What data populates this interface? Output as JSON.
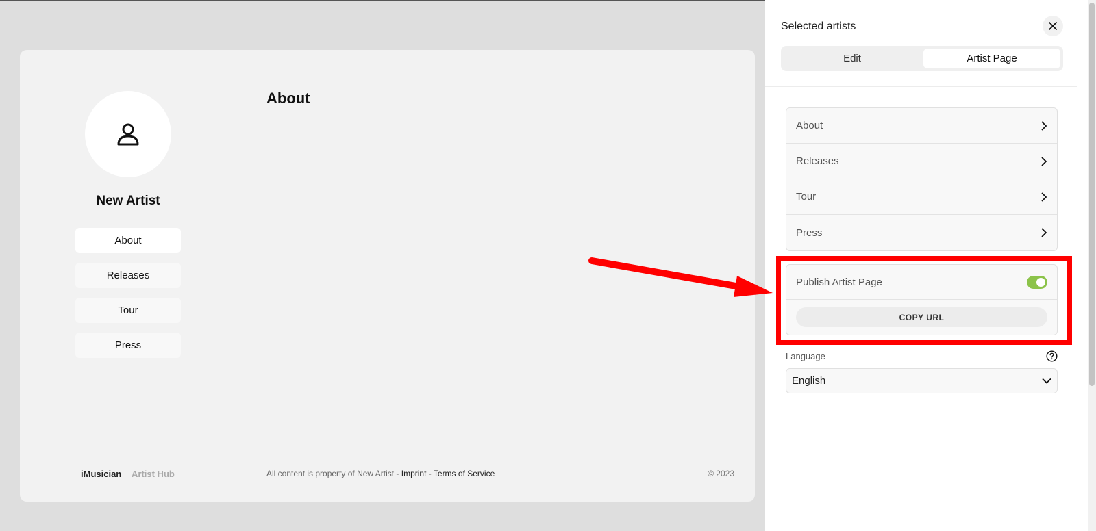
{
  "preview": {
    "artist_name": "New Artist",
    "nav": [
      {
        "label": "About"
      },
      {
        "label": "Releases"
      },
      {
        "label": "Tour"
      },
      {
        "label": "Press"
      }
    ],
    "section_title": "About",
    "footer": {
      "brand": "iMusician",
      "brand_sub": "Artist Hub",
      "legal_prefix": "All content is property of New Artist - ",
      "imprint": "Imprint",
      "separator": " - ",
      "terms": "Terms of Service",
      "copyright": "© 2023"
    }
  },
  "panel": {
    "title": "Selected artists",
    "tabs": [
      {
        "label": "Edit",
        "active": false
      },
      {
        "label": "Artist Page",
        "active": true
      }
    ],
    "sections": [
      {
        "label": "About"
      },
      {
        "label": "Releases"
      },
      {
        "label": "Tour"
      },
      {
        "label": "Press"
      }
    ],
    "publish_label": "Publish Artist Page",
    "publish_enabled": true,
    "copy_url_label": "COPY URL",
    "language_label": "Language",
    "language_value": "English"
  },
  "colors": {
    "toggle_on": "#8cc34a",
    "annotation": "#ff0000"
  }
}
